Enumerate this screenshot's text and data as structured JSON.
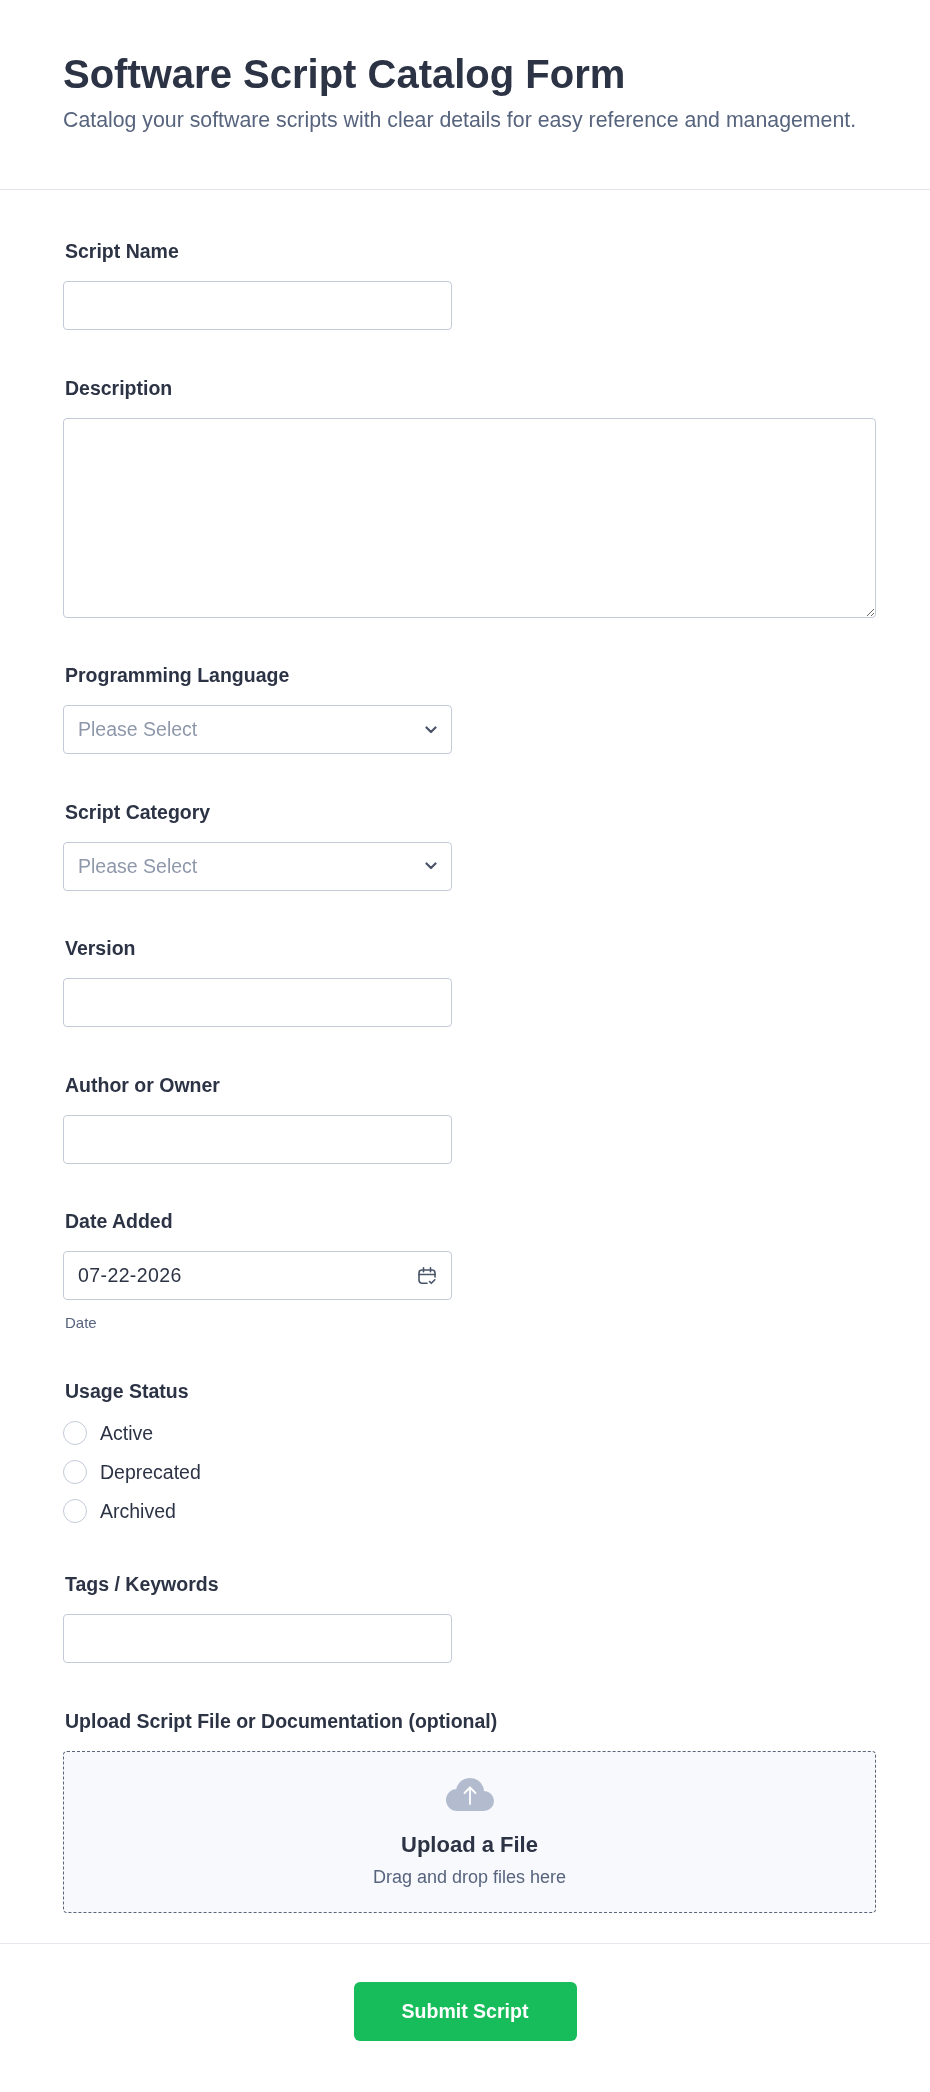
{
  "header": {
    "title": "Software Script Catalog Form",
    "subtitle": "Catalog your software scripts with clear details for easy reference and management."
  },
  "fields": [
    {
      "kind": "text",
      "label": "Script Name"
    },
    {
      "kind": "textarea",
      "label": "Description"
    },
    {
      "kind": "select",
      "label": "Programming Language",
      "placeholder": "Please Select"
    },
    {
      "kind": "select",
      "label": "Script Category",
      "placeholder": "Please Select"
    },
    {
      "kind": "text",
      "label": "Version"
    },
    {
      "kind": "text",
      "label": "Author or Owner"
    },
    {
      "kind": "date",
      "label": "Date Added",
      "value": "07-22-2026",
      "sublabel": "Date"
    },
    {
      "kind": "radio",
      "label": "Usage Status",
      "options": [
        {
          "label": "Active",
          "selected": false
        },
        {
          "label": "Deprecated",
          "selected": false
        },
        {
          "label": "Archived",
          "selected": false
        }
      ]
    },
    {
      "kind": "text",
      "label": "Tags / Keywords"
    },
    {
      "kind": "upload",
      "label": "Upload Script File or Documentation (optional)",
      "title": "Upload a File",
      "hint": "Drag and drop files here"
    }
  ],
  "submit_button": {
    "label": "Submit Script"
  }
}
